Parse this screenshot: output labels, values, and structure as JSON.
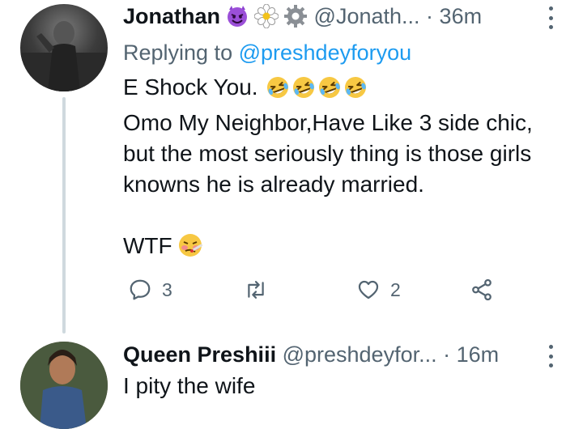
{
  "tweet1": {
    "name": "Jonathan",
    "name_emojis": [
      "smiling-imp-emoji",
      "flower-emoji",
      "gear-emoji"
    ],
    "handle": "@Jonath...",
    "separator": "·",
    "time": "36m",
    "replying_label": "Replying to",
    "replying_mention": "@preshdeyforyou",
    "line1_text": "E Shock You.",
    "line1_emojis": [
      "rolling-laughing-emoji",
      "rolling-laughing-emoji",
      "rolling-laughing-emoji",
      "rolling-laughing-emoji"
    ],
    "line2": "Omo My Neighbor,Have Like 3 side chic,",
    "line3": "but the most seriously thing is those girls",
    "line4": "knowns he is already married.",
    "line5_text": "WTF",
    "line5_emoji": "face-with-thermometer-emoji",
    "reply_count": "3",
    "retweet_count": "",
    "like_count": "2"
  },
  "tweet2": {
    "name": "Queen Preshiii",
    "handle": "@preshdeyfor...",
    "separator": "·",
    "time": "16m",
    "text": "I pity the wife"
  },
  "colors": {
    "text": "#0f1419",
    "secondary": "#536471",
    "link": "#1d9bf0",
    "thread_line": "#cfd9de"
  }
}
